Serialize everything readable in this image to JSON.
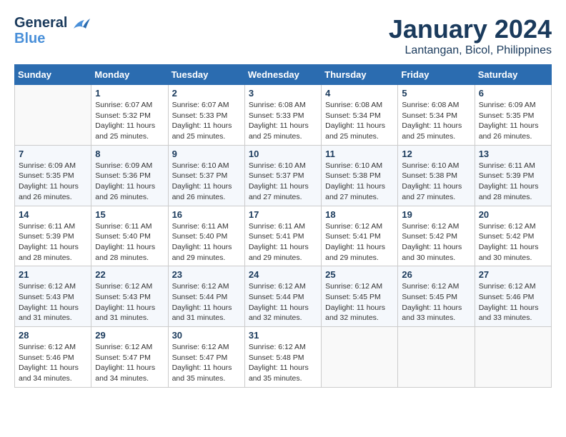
{
  "logo": {
    "line1": "General",
    "line2": "Blue"
  },
  "title": "January 2024",
  "location": "Lantangan, Bicol, Philippines",
  "days_of_week": [
    "Sunday",
    "Monday",
    "Tuesday",
    "Wednesday",
    "Thursday",
    "Friday",
    "Saturday"
  ],
  "weeks": [
    [
      {
        "day": "",
        "sunrise": "",
        "sunset": "",
        "daylight": ""
      },
      {
        "day": "1",
        "sunrise": "Sunrise: 6:07 AM",
        "sunset": "Sunset: 5:32 PM",
        "daylight": "Daylight: 11 hours and 25 minutes."
      },
      {
        "day": "2",
        "sunrise": "Sunrise: 6:07 AM",
        "sunset": "Sunset: 5:33 PM",
        "daylight": "Daylight: 11 hours and 25 minutes."
      },
      {
        "day": "3",
        "sunrise": "Sunrise: 6:08 AM",
        "sunset": "Sunset: 5:33 PM",
        "daylight": "Daylight: 11 hours and 25 minutes."
      },
      {
        "day": "4",
        "sunrise": "Sunrise: 6:08 AM",
        "sunset": "Sunset: 5:34 PM",
        "daylight": "Daylight: 11 hours and 25 minutes."
      },
      {
        "day": "5",
        "sunrise": "Sunrise: 6:08 AM",
        "sunset": "Sunset: 5:34 PM",
        "daylight": "Daylight: 11 hours and 25 minutes."
      },
      {
        "day": "6",
        "sunrise": "Sunrise: 6:09 AM",
        "sunset": "Sunset: 5:35 PM",
        "daylight": "Daylight: 11 hours and 26 minutes."
      }
    ],
    [
      {
        "day": "7",
        "sunrise": "Sunrise: 6:09 AM",
        "sunset": "Sunset: 5:35 PM",
        "daylight": "Daylight: 11 hours and 26 minutes."
      },
      {
        "day": "8",
        "sunrise": "Sunrise: 6:09 AM",
        "sunset": "Sunset: 5:36 PM",
        "daylight": "Daylight: 11 hours and 26 minutes."
      },
      {
        "day": "9",
        "sunrise": "Sunrise: 6:10 AM",
        "sunset": "Sunset: 5:37 PM",
        "daylight": "Daylight: 11 hours and 26 minutes."
      },
      {
        "day": "10",
        "sunrise": "Sunrise: 6:10 AM",
        "sunset": "Sunset: 5:37 PM",
        "daylight": "Daylight: 11 hours and 27 minutes."
      },
      {
        "day": "11",
        "sunrise": "Sunrise: 6:10 AM",
        "sunset": "Sunset: 5:38 PM",
        "daylight": "Daylight: 11 hours and 27 minutes."
      },
      {
        "day": "12",
        "sunrise": "Sunrise: 6:10 AM",
        "sunset": "Sunset: 5:38 PM",
        "daylight": "Daylight: 11 hours and 27 minutes."
      },
      {
        "day": "13",
        "sunrise": "Sunrise: 6:11 AM",
        "sunset": "Sunset: 5:39 PM",
        "daylight": "Daylight: 11 hours and 28 minutes."
      }
    ],
    [
      {
        "day": "14",
        "sunrise": "Sunrise: 6:11 AM",
        "sunset": "Sunset: 5:39 PM",
        "daylight": "Daylight: 11 hours and 28 minutes."
      },
      {
        "day": "15",
        "sunrise": "Sunrise: 6:11 AM",
        "sunset": "Sunset: 5:40 PM",
        "daylight": "Daylight: 11 hours and 28 minutes."
      },
      {
        "day": "16",
        "sunrise": "Sunrise: 6:11 AM",
        "sunset": "Sunset: 5:40 PM",
        "daylight": "Daylight: 11 hours and 29 minutes."
      },
      {
        "day": "17",
        "sunrise": "Sunrise: 6:11 AM",
        "sunset": "Sunset: 5:41 PM",
        "daylight": "Daylight: 11 hours and 29 minutes."
      },
      {
        "day": "18",
        "sunrise": "Sunrise: 6:12 AM",
        "sunset": "Sunset: 5:41 PM",
        "daylight": "Daylight: 11 hours and 29 minutes."
      },
      {
        "day": "19",
        "sunrise": "Sunrise: 6:12 AM",
        "sunset": "Sunset: 5:42 PM",
        "daylight": "Daylight: 11 hours and 30 minutes."
      },
      {
        "day": "20",
        "sunrise": "Sunrise: 6:12 AM",
        "sunset": "Sunset: 5:42 PM",
        "daylight": "Daylight: 11 hours and 30 minutes."
      }
    ],
    [
      {
        "day": "21",
        "sunrise": "Sunrise: 6:12 AM",
        "sunset": "Sunset: 5:43 PM",
        "daylight": "Daylight: 11 hours and 31 minutes."
      },
      {
        "day": "22",
        "sunrise": "Sunrise: 6:12 AM",
        "sunset": "Sunset: 5:43 PM",
        "daylight": "Daylight: 11 hours and 31 minutes."
      },
      {
        "day": "23",
        "sunrise": "Sunrise: 6:12 AM",
        "sunset": "Sunset: 5:44 PM",
        "daylight": "Daylight: 11 hours and 31 minutes."
      },
      {
        "day": "24",
        "sunrise": "Sunrise: 6:12 AM",
        "sunset": "Sunset: 5:44 PM",
        "daylight": "Daylight: 11 hours and 32 minutes."
      },
      {
        "day": "25",
        "sunrise": "Sunrise: 6:12 AM",
        "sunset": "Sunset: 5:45 PM",
        "daylight": "Daylight: 11 hours and 32 minutes."
      },
      {
        "day": "26",
        "sunrise": "Sunrise: 6:12 AM",
        "sunset": "Sunset: 5:45 PM",
        "daylight": "Daylight: 11 hours and 33 minutes."
      },
      {
        "day": "27",
        "sunrise": "Sunrise: 6:12 AM",
        "sunset": "Sunset: 5:46 PM",
        "daylight": "Daylight: 11 hours and 33 minutes."
      }
    ],
    [
      {
        "day": "28",
        "sunrise": "Sunrise: 6:12 AM",
        "sunset": "Sunset: 5:46 PM",
        "daylight": "Daylight: 11 hours and 34 minutes."
      },
      {
        "day": "29",
        "sunrise": "Sunrise: 6:12 AM",
        "sunset": "Sunset: 5:47 PM",
        "daylight": "Daylight: 11 hours and 34 minutes."
      },
      {
        "day": "30",
        "sunrise": "Sunrise: 6:12 AM",
        "sunset": "Sunset: 5:47 PM",
        "daylight": "Daylight: 11 hours and 35 minutes."
      },
      {
        "day": "31",
        "sunrise": "Sunrise: 6:12 AM",
        "sunset": "Sunset: 5:48 PM",
        "daylight": "Daylight: 11 hours and 35 minutes."
      },
      {
        "day": "",
        "sunrise": "",
        "sunset": "",
        "daylight": ""
      },
      {
        "day": "",
        "sunrise": "",
        "sunset": "",
        "daylight": ""
      },
      {
        "day": "",
        "sunrise": "",
        "sunset": "",
        "daylight": ""
      }
    ]
  ]
}
